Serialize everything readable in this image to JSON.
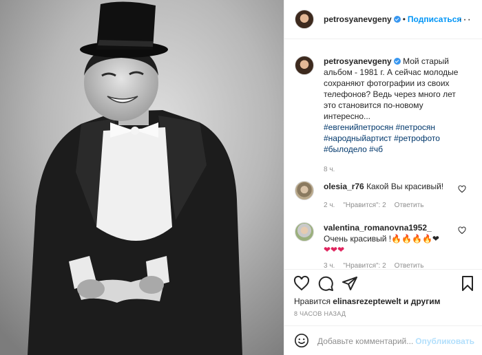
{
  "post": {
    "author": "petrosyanevgeny",
    "follow_label": "Подписаться",
    "dot": "•",
    "more_label": "···"
  },
  "caption": {
    "username": "petrosyanevgeny",
    "line1": "Мой старый",
    "line2": "альбом - 1981 г. А сейчас молодые",
    "line3": "сохраняют фотографии из своих",
    "line4": "телефонов? Ведь через много лет",
    "line5": "это становится по-новому",
    "line6": "интересно...",
    "tags1": "#евгенийпетросян #петросян",
    "tags2": "#народныйартист #ретрофото",
    "tags3": "#былодело #чб",
    "time": "8 ч."
  },
  "comments": [
    {
      "username": "olesia_r76",
      "text": "Какой Вы красивый!",
      "time": "2 ч.",
      "likes": "\"Нравится\": 2",
      "reply": "Ответить"
    },
    {
      "username": "valentina_romanovna1952_",
      "text": "Очень красивый !🔥🔥🔥🔥❤",
      "text2": "❤❤❤",
      "time": "3 ч.",
      "likes": "\"Нравится\": 2",
      "reply": "Ответить"
    }
  ],
  "likes": {
    "prefix": "Нравится",
    "user": "elinasrezeptewelt",
    "suffix": "и другим"
  },
  "timestamp": "8 ЧАСОВ НАЗАД",
  "add_comment": {
    "placeholder": "Добавьте комментарий...",
    "publish_label": "Опубликовать"
  },
  "icons": {
    "like": "heart-icon",
    "comment": "comment-icon",
    "share": "share-icon",
    "save": "bookmark-icon",
    "emoji": "emoji-icon",
    "verified": "verified-badge-icon",
    "more": "more-options-icon"
  },
  "colors": {
    "link": "#0095f6",
    "hashtag": "#00376b",
    "verified": "#3897f0",
    "muted": "#8e8e8e"
  }
}
